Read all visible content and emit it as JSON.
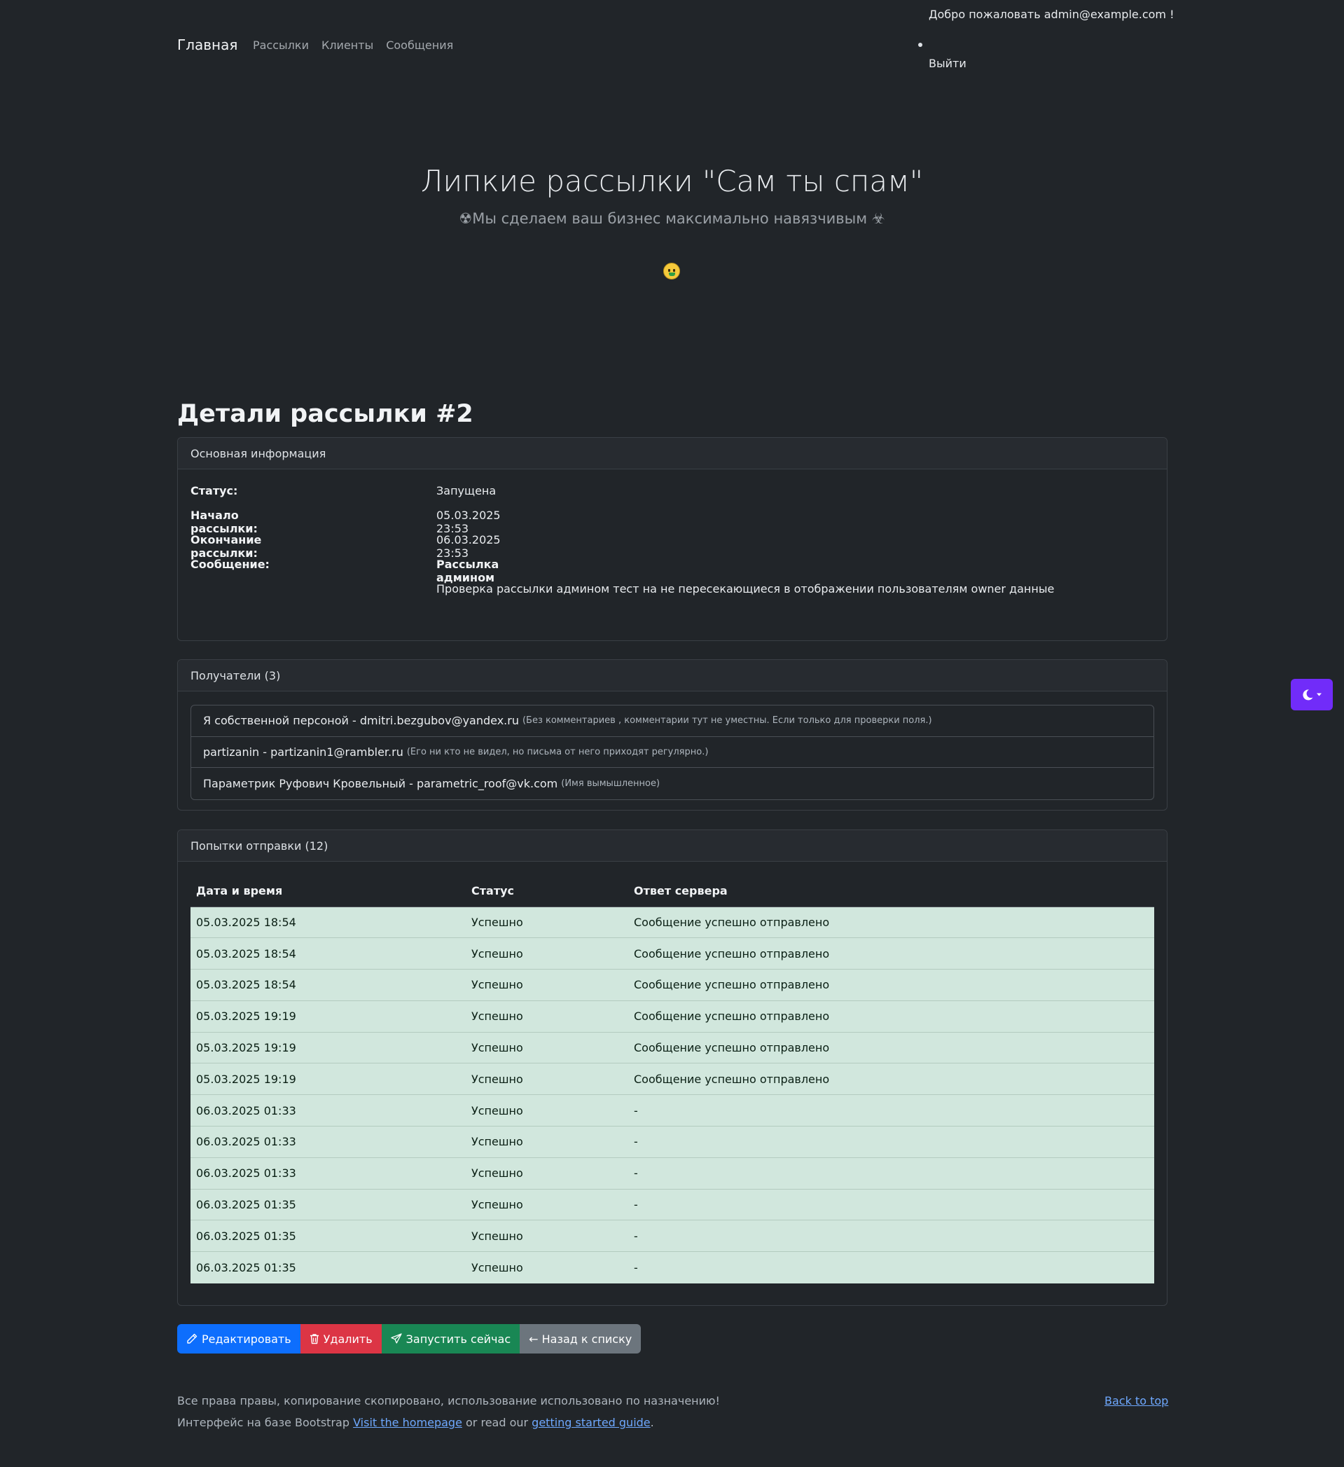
{
  "nav": {
    "brand": "Главная",
    "links": [
      "Рассылки",
      "Клиенты",
      "Сообщения"
    ],
    "welcome": "Добро пожаловать admin@example.com !",
    "logout": "Выйти"
  },
  "hero": {
    "title": "Липкие рассылки \"Сам ты спам\"",
    "subtitle": "☢Мы сделаем ваш бизнес максимально навязчивым ☣"
  },
  "page": {
    "heading": "Детали рассылки #2"
  },
  "info": {
    "header": "Основная информация",
    "status_label": "Статус:",
    "status_value": "Запущена",
    "start_label": "Начало рассылки:",
    "start_value": "05.03.2025 23:53",
    "end_label": "Окончание рассылки:",
    "end_value": "06.03.2025 23:53",
    "message_label": "Сообщение:",
    "message_subject": "Рассылка админом",
    "message_body": "Проверка рассылки админом тест на не пересекающиеся в отображении пользователям owner данные"
  },
  "recipients": {
    "header": "Получатели (3)",
    "items": [
      {
        "main": "Я собственной персоной - dmitri.bezgubov@yandex.ru",
        "note": "(Без комментариев , комментарии тут не уместны. Если только для проверки поля.)"
      },
      {
        "main": "partizanin - partizanin1@rambler.ru",
        "note": "(Его ни кто не видел, но письма от него приходят регулярно.)"
      },
      {
        "main": "Параметрик Руфович Кровельный - parametric_roof@vk.com",
        "note": "(Имя вымышленное)"
      }
    ]
  },
  "attempts": {
    "header": "Попытки отправки (12)",
    "columns": [
      "Дата и время",
      "Статус",
      "Ответ сервера"
    ],
    "rows": [
      [
        "05.03.2025 18:54",
        "Успешно",
        "Сообщение успешно отправлено"
      ],
      [
        "05.03.2025 18:54",
        "Успешно",
        "Сообщение успешно отправлено"
      ],
      [
        "05.03.2025 18:54",
        "Успешно",
        "Сообщение успешно отправлено"
      ],
      [
        "05.03.2025 19:19",
        "Успешно",
        "Сообщение успешно отправлено"
      ],
      [
        "05.03.2025 19:19",
        "Успешно",
        "Сообщение успешно отправлено"
      ],
      [
        "05.03.2025 19:19",
        "Успешно",
        "Сообщение успешно отправлено"
      ],
      [
        "06.03.2025 01:33",
        "Успешно",
        "-"
      ],
      [
        "06.03.2025 01:33",
        "Успешно",
        "-"
      ],
      [
        "06.03.2025 01:33",
        "Успешно",
        "-"
      ],
      [
        "06.03.2025 01:35",
        "Успешно",
        "-"
      ],
      [
        "06.03.2025 01:35",
        "Успешно",
        "-"
      ],
      [
        "06.03.2025 01:35",
        "Успешно",
        "-"
      ]
    ]
  },
  "actions": {
    "edit": "Редактировать",
    "delete": "Удалить",
    "run": "Запустить сейчас",
    "back": "← Назад к списку"
  },
  "footer": {
    "line1": "Все права правы, копирование скопировано, использование использовано по назначению!",
    "line2_prefix": "Интерфейс на базе Bootstrap ",
    "homepage_link": "Visit the homepage",
    "line2_middle": " or read our ",
    "guide_link": "getting started guide",
    "line2_suffix": ".",
    "back_to_top": "Back to top"
  },
  "icons": {
    "theme_toggle": "moon-icon",
    "edit": "pencil-icon",
    "delete": "trash-icon",
    "run": "send-icon",
    "hero": "money-mouth-face-emoji"
  },
  "colors": {
    "background": "#212529",
    "success_row": "#d1e7dd",
    "primary": "#0d6efd",
    "danger": "#dc3545",
    "success": "#198754",
    "secondary": "#6c757d",
    "theme_toggle": "#712cf9",
    "link": "#6ea8fe"
  }
}
